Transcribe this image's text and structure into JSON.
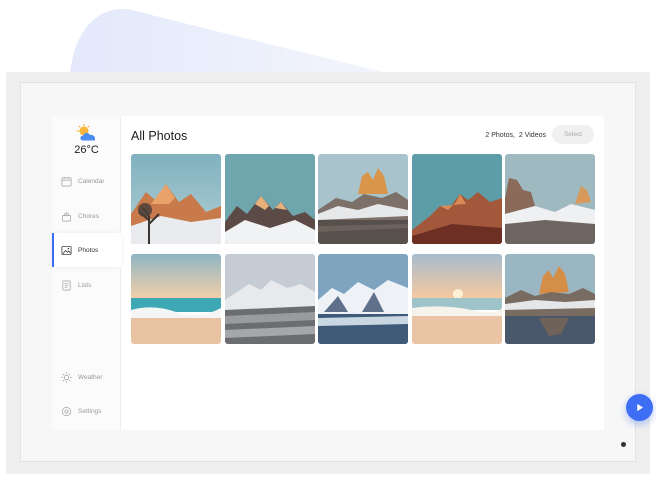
{
  "weather": {
    "temperature": "26°C",
    "icon": "sun-cloud-icon"
  },
  "sidebar": {
    "items": [
      {
        "label": "Calendar",
        "icon": "calendar-icon"
      },
      {
        "label": "Chores",
        "icon": "chores-icon"
      },
      {
        "label": "Photos",
        "icon": "photos-icon",
        "active": true
      },
      {
        "label": "Lists",
        "icon": "list-icon"
      },
      {
        "label": "Weather",
        "icon": "sun-icon"
      },
      {
        "label": "Settings",
        "icon": "gear-icon"
      }
    ]
  },
  "header": {
    "title": "All Photos",
    "photo_count": "2 Photos,",
    "video_count": "2 Videos",
    "select_label": "Select"
  },
  "photos": [
    {
      "subject": "mountain-sunset-tree"
    },
    {
      "subject": "snowy-peaks-teal-sky"
    },
    {
      "subject": "golden-granite-towers"
    },
    {
      "subject": "red-rock-mountains"
    },
    {
      "subject": "snowy-ridge-golden-peaks"
    },
    {
      "subject": "beach-waves-dusk"
    },
    {
      "subject": "snowy-forest-mountains"
    },
    {
      "subject": "glacier-lake"
    },
    {
      "subject": "beach-sunset"
    },
    {
      "subject": "mountain-lake-reflection"
    }
  ],
  "colors": {
    "accent": "#3e6ef4",
    "active_bar": "#3b6ef5"
  }
}
